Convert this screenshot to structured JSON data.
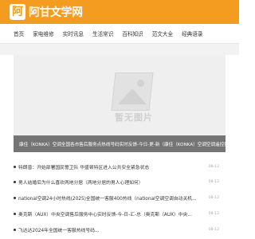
{
  "site": {
    "logo_mark": "阿",
    "name": "阿甘文学网"
  },
  "nav": [
    "首页",
    "家电维修",
    "实时讯息",
    "生活常识",
    "百科知识",
    "范文大全",
    "经典语录"
  ],
  "banner": {
    "placeholder_text": "暂无图片",
    "caption": "康佳（KONKA）空调全国各市售后服务点热线号码实时反馈-今日-更-新（康佳（KONKA）空调空调遥控器模式）"
  },
  "news": [
    {
      "title": "特朗普：开始部署国民警卫队 华盛顿特区进入公共安全紧急状态",
      "date": "08-12"
    },
    {
      "title": "男人结婚后为什么喜欢两地分居（两地分居的男人心理如何）",
      "date": "08-12"
    },
    {
      "title": "national空调24小时热线(2025)全国统一客服400热线（national空调空调自动关机...",
      "date": "08-12"
    },
    {
      "title": "奥克斯（AUX）中央空调售后服务中心实时反馈-今-日-汇-总（奥克斯（AUX）中央...",
      "date": "08-12"
    },
    {
      "title": "飞达达2024年全国统一客服热线号码...",
      "date": "08-12"
    }
  ]
}
